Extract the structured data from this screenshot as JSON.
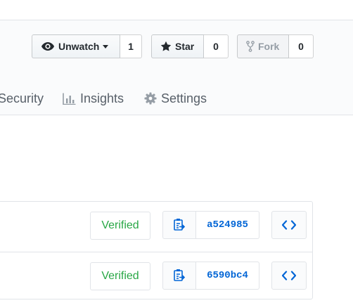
{
  "pagehead": {
    "actions": {
      "watch": {
        "label": "Unwatch",
        "count": "1",
        "icon": "eye-icon"
      },
      "star": {
        "label": "Star",
        "count": "0",
        "icon": "star-icon"
      },
      "fork": {
        "label": "Fork",
        "count": "0",
        "icon": "fork-icon",
        "disabled": true
      }
    }
  },
  "reponav": {
    "items": [
      {
        "label": "Security",
        "icon": ""
      },
      {
        "label": "Insights",
        "icon": "graph-icon"
      },
      {
        "label": "Settings",
        "icon": "gear-icon"
      }
    ]
  },
  "commits": [
    {
      "verified": "Verified",
      "sha": "a524985"
    },
    {
      "verified": "Verified",
      "sha": "6590bc4"
    }
  ],
  "colors": {
    "link": "#0366d6",
    "verified": "#28a745",
    "text": "#24292e",
    "muted": "#586069",
    "border": "#e1e4e8"
  }
}
